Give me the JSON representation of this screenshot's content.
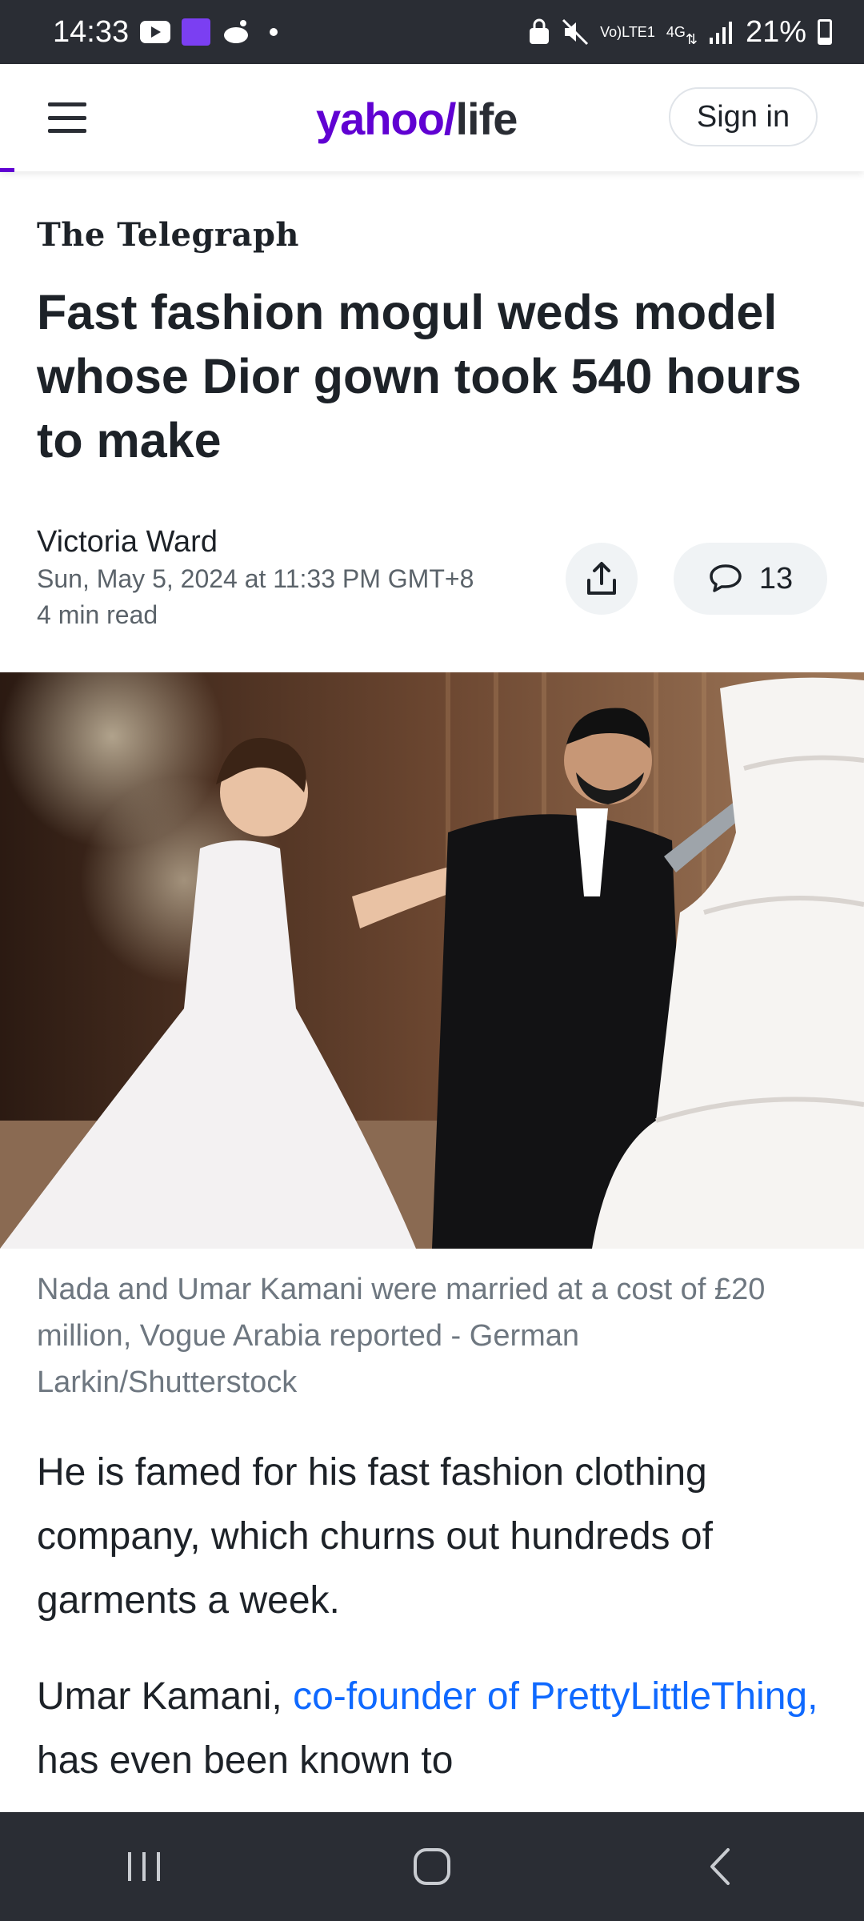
{
  "status_bar": {
    "time": "14:33",
    "network_top": "Vo)",
    "network_bottom": "LTE1",
    "net_type": "4G",
    "battery": "21%"
  },
  "header": {
    "logo_main": "yahoo/",
    "logo_sub": "life",
    "signin_label": "Sign in",
    "brand_color": "#6001d2"
  },
  "article": {
    "publisher": "The Telegraph",
    "headline": "Fast fashion mogul weds model whose Dior gown took 540 hours to make",
    "author": "Victoria Ward",
    "date": "Sun, May 5, 2024 at 11:33 PM GMT+8",
    "read_time": "4 min read",
    "comment_count": "13",
    "image_caption": "Nada and Umar Kamani were married at a cost of £20 million, Vogue Arabia reported - German Larkin/Shutterstock",
    "paragraph1": "He is famed for his fast fashion clothing company, which churns out hundreds of garments a week.",
    "paragraph2_start": "Umar Kamani, ",
    "paragraph2_link": "co-founder of PrettyLittleThing,",
    "paragraph2_end": " has even been known to"
  },
  "icons": {
    "share": "share-icon",
    "comment": "comment-icon",
    "nav_recents": "recents-icon",
    "nav_home": "home-icon",
    "nav_back": "back-icon"
  }
}
